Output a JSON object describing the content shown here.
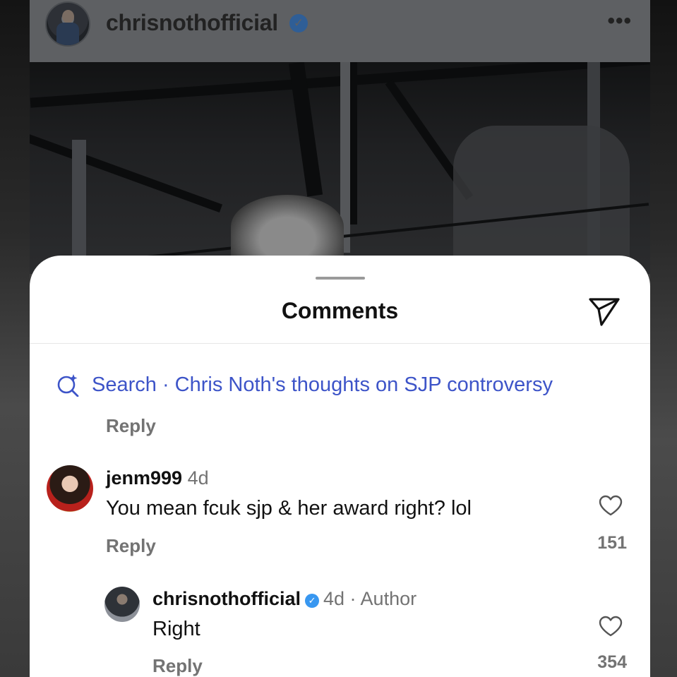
{
  "post": {
    "username": "chrisnothofficial",
    "more_label": "•••"
  },
  "comments_sheet": {
    "title": "Comments",
    "search_label": "Search · Chris Noth's thoughts on SJP controversy",
    "partial_reply_label": "Reply"
  },
  "comments": [
    {
      "username": "jenm999",
      "time": "4d",
      "text": "You mean fcuk sjp & her award right? lol",
      "reply_label": "Reply",
      "likes": "151"
    },
    {
      "username": "chrisnothofficial",
      "time": "4d · Author",
      "text": "Right",
      "reply_label": "Reply",
      "likes": "354"
    }
  ],
  "colors": {
    "link_blue": "#3d54c8",
    "verified_blue": "#3897f0",
    "muted_text": "#737373"
  },
  "icons": [
    "verified-badge-icon",
    "more-options-icon",
    "send-icon",
    "search-sparkle-icon",
    "heart-icon"
  ]
}
